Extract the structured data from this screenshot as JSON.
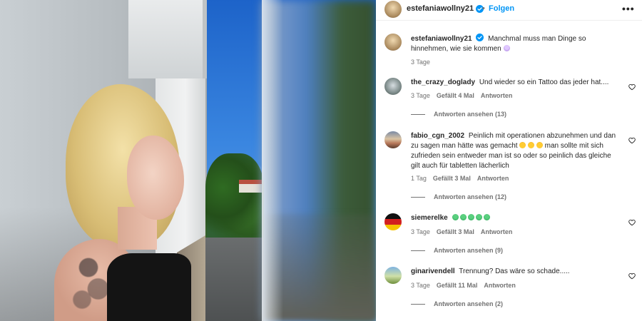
{
  "post": {
    "username": "estefaniawollny21",
    "follow_label": "Folgen",
    "separator": "•",
    "more_label": "•••",
    "caption_text": "Manchmal muss man Dinge so hinnehmen, wie sie kommen",
    "caption_time": "3 Tage"
  },
  "comments": [
    {
      "username": "the_crazy_doglady",
      "text": "Und wieder so ein Tattoo das jeder hat....",
      "time": "3 Tage",
      "likes": "Gefällt 4 Mal",
      "reply_label": "Antworten",
      "replies_label": "Antworten ansehen (13)"
    },
    {
      "username": "fabio_cgn_2002",
      "text_part1": "Peinlich mit operationen abzunehmen und dan zu sagen man hätte was gemacht",
      "text_part2": "man sollte mit sich zufrieden sein entweder man ist so oder so peinlich das gleiche gilt auch für tabletten lächerlich",
      "time": "1 Tag",
      "likes": "Gefällt 3 Mal",
      "reply_label": "Antworten",
      "replies_label": "Antworten ansehen (12)"
    },
    {
      "username": "siemerelke",
      "time": "3 Tage",
      "likes": "Gefällt 3 Mal",
      "reply_label": "Antworten",
      "replies_label": "Antworten ansehen (9)"
    },
    {
      "username": "ginarivendell",
      "text": "Trennung? Das wäre so schade.....",
      "time": "3 Tage",
      "likes": "Gefällt 11 Mal",
      "reply_label": "Antworten",
      "replies_label": "Antworten ansehen (2)"
    }
  ],
  "colors": {
    "link_blue": "#0095f6",
    "text": "#262626",
    "secondary": "#737373",
    "verified": "#0095f6"
  }
}
